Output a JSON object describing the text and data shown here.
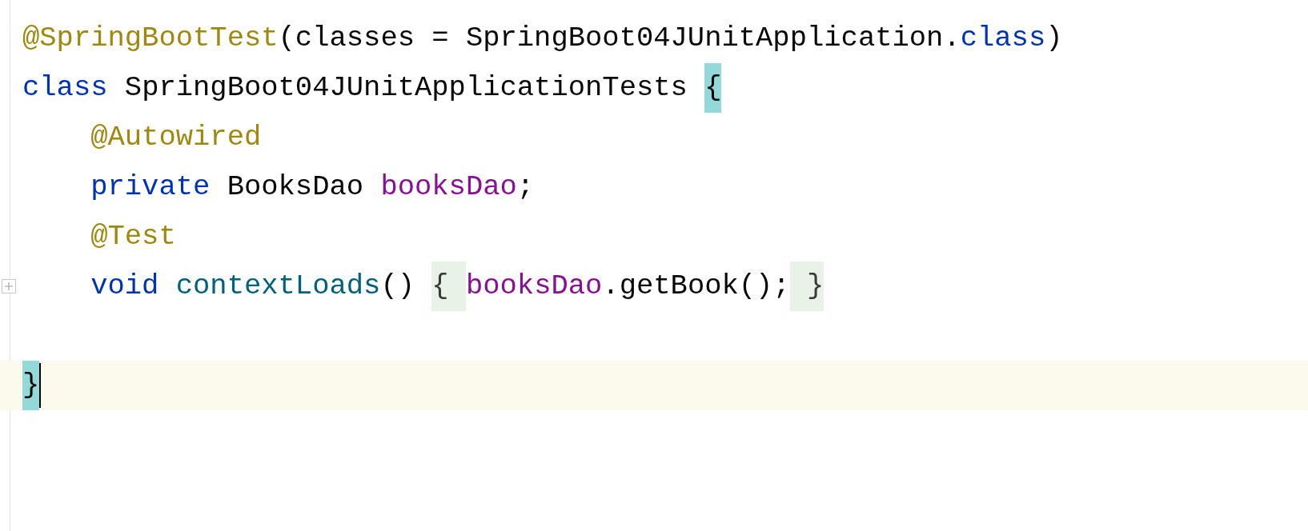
{
  "editor": {
    "lines": [
      {
        "current": false,
        "fold_marker": false,
        "caret": false,
        "tokens": [
          {
            "text": "@SpringBootTest",
            "kind": "annotation"
          },
          {
            "text": "(classes = SpringBoot04JUnitApplication.",
            "kind": "plain"
          },
          {
            "text": "class",
            "kind": "keyword"
          },
          {
            "text": ")",
            "kind": "plain"
          }
        ]
      },
      {
        "current": false,
        "fold_marker": false,
        "caret": false,
        "tokens": [
          {
            "text": "class",
            "kind": "keyword"
          },
          {
            "text": " SpringBoot04JUnitApplicationTests ",
            "kind": "plain"
          },
          {
            "text": "{",
            "kind": "brace-match"
          }
        ],
        "children": [
          {
            "current": false,
            "fold_marker": false,
            "caret": false,
            "tokens": [
              {
                "text": "@Autowired",
                "kind": "annotation"
              }
            ]
          },
          {
            "current": false,
            "fold_marker": false,
            "caret": false,
            "tokens": [
              {
                "text": "private",
                "kind": "keyword"
              },
              {
                "text": " BooksDao ",
                "kind": "plain"
              },
              {
                "text": "booksDao",
                "kind": "field"
              },
              {
                "text": ";",
                "kind": "plain"
              }
            ]
          },
          {
            "current": false,
            "fold_marker": false,
            "caret": false,
            "tokens": [
              {
                "text": "@Test",
                "kind": "annotation"
              }
            ]
          },
          {
            "current": false,
            "fold_marker": true,
            "caret": false,
            "tokens": [
              {
                "text": "void ",
                "kind": "keyword"
              },
              {
                "text": "contextLoads",
                "kind": "method"
              },
              {
                "text": "() ",
                "kind": "plain"
              },
              {
                "text": "{ ",
                "kind": "fold-brace"
              },
              {
                "text": "booksDao",
                "kind": "field"
              },
              {
                "text": ".getBook();",
                "kind": "plain"
              },
              {
                "text": " }",
                "kind": "fold-brace"
              }
            ]
          },
          {
            "current": false,
            "fold_marker": false,
            "caret": false
          }
        ]
      },
      {
        "current": true,
        "fold_marker": false,
        "caret": true,
        "tokens": [
          {
            "text": "}",
            "kind": "brace-match"
          }
        ]
      }
    ]
  }
}
